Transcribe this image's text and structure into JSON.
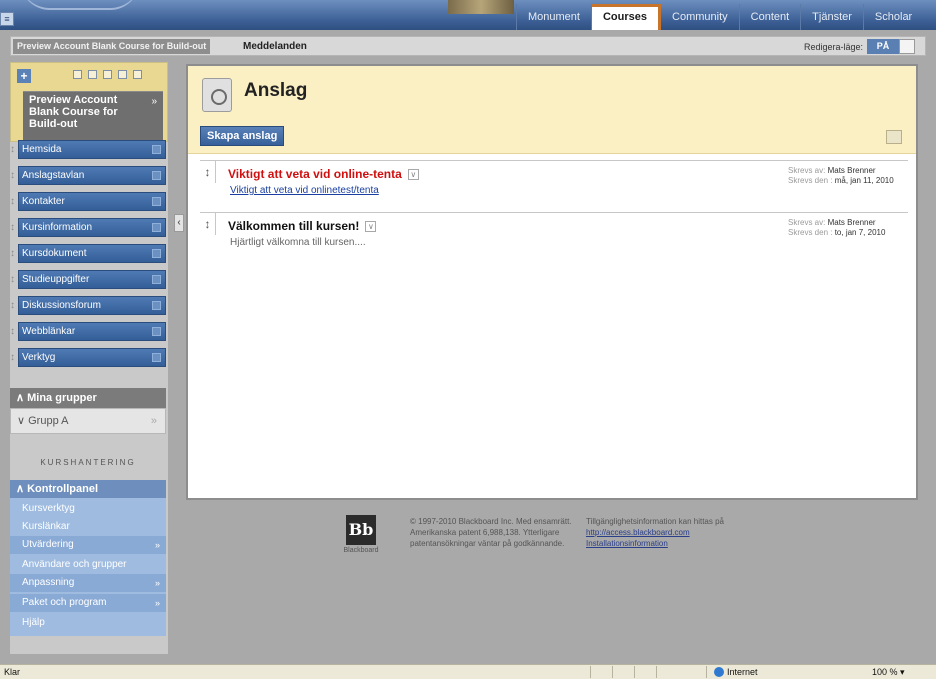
{
  "top_tabs": [
    "Monument",
    "Courses",
    "Community",
    "Content",
    "Tjänster",
    "Scholar"
  ],
  "active_tab": "Courses",
  "breadcrumb": {
    "course": "Preview Account Blank Course for Build-out",
    "page": "Meddelanden"
  },
  "edit_mode": {
    "label": "Redigera-läge:",
    "value": "PÅ"
  },
  "sidebar": {
    "course_title": "Preview Account Blank Course for Build-out",
    "items": [
      {
        "label": "Hemsida"
      },
      {
        "label": "Anslagstavlan"
      },
      {
        "label": "Kontakter"
      },
      {
        "label": "Kursinformation"
      },
      {
        "label": "Kursdokument"
      },
      {
        "label": "Studieuppgifter"
      },
      {
        "label": "Diskussionsforum"
      },
      {
        "label": "Webblänkar"
      },
      {
        "label": "Verktyg"
      }
    ],
    "groups_title": "Mina grupper",
    "groups": [
      "Grupp A"
    ],
    "management_label": "KURSHANTERING",
    "control_panel_title": "Kontrollpanel",
    "control_items": [
      {
        "label": "Kursverktyg"
      },
      {
        "label": "Kurslänkar"
      },
      {
        "label": "Utvärdering"
      },
      {
        "label": "Användare och grupper"
      },
      {
        "label": "Anpassning"
      },
      {
        "label": "Paket och program"
      },
      {
        "label": "Hjälp"
      }
    ]
  },
  "main": {
    "title": "Anslag",
    "create_button": "Skapa anslag",
    "announcements": [
      {
        "title": "Viktigt att veta vid online-tenta",
        "body": "Viktigt att veta vid onlinetest/tenta",
        "author_label": "Skrevs av:",
        "author": "Mats Brenner",
        "date_label": "Skrevs den :",
        "date": "må, jan 11, 2010"
      },
      {
        "title": "Välkommen till kursen!",
        "body": "Hjärtligt välkomna till kursen....",
        "author_label": "Skrevs av:",
        "author": "Mats Brenner",
        "date_label": "Skrevs den :",
        "date": "to, jan 7, 2010"
      }
    ]
  },
  "footer": {
    "logo": "Bb",
    "logo_sub": "Blackboard",
    "copyright": "© 1997-2010 Blackboard Inc. Med ensamrätt. Amerikanska patent 6,988,138. Ytterligare patentansökningar väntar på godkännande.",
    "access_text": "Tillgänglighetsinformation kan hittas på",
    "access_link": "http://access.blackboard.com",
    "install_link": "Installationsinformation"
  },
  "statusbar": {
    "left": "Klar",
    "zone": "Internet",
    "zoom": "100 %"
  },
  "colors": {
    "nav_blue": "#3f6aa5",
    "accent_orange": "#c8742b",
    "alert_red": "#d01010",
    "header_yellow": "#fbefc4"
  }
}
